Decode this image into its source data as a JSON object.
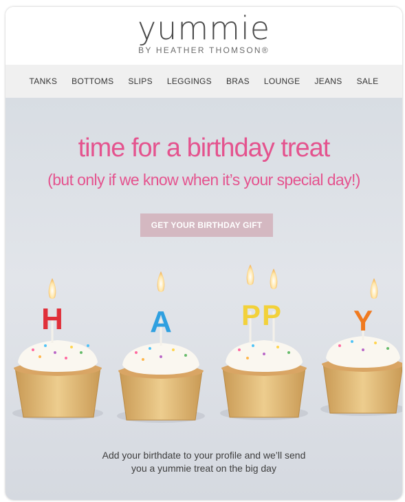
{
  "brand": {
    "logo": "yummie",
    "tagline": "BY HEATHER THOMSON®"
  },
  "nav": {
    "items": [
      "TANKS",
      "BOTTOMS",
      "SLIPS",
      "LEGGINGS",
      "BRAS",
      "LOUNGE",
      "JEANS",
      "SALE"
    ]
  },
  "hero": {
    "headline": "time for a birthday treat",
    "subheadline": "(but only if we know when it’s your special day!)",
    "cta_label": "GET YOUR BIRTHDAY GIFT",
    "candles": [
      "H",
      "A",
      "PP",
      "Y"
    ],
    "caption_line1": "Add your birthdate to your profile and we’ll send",
    "caption_line2": "you a yummie treat on the big day"
  },
  "colors": {
    "accent_pink": "#e4538e",
    "cta_bg": "#d4b8c1",
    "nav_bg": "#f0f0f0"
  }
}
